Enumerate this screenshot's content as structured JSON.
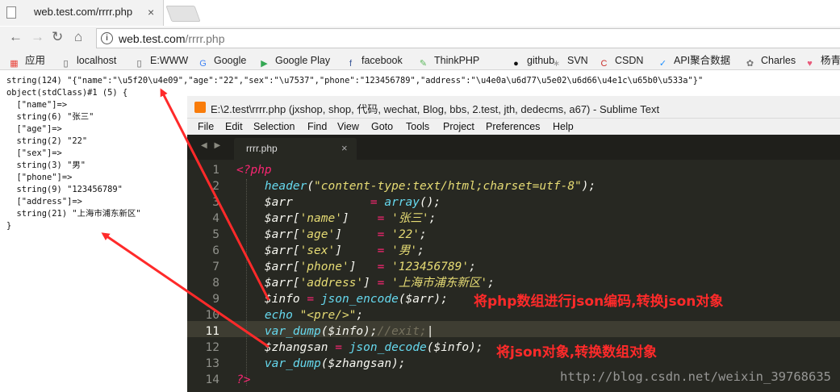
{
  "browser": {
    "tab_title": "web.test.com/rrrr.php",
    "tab_close": "×",
    "url_host": "web.test.com",
    "url_path": "/rrrr.php",
    "nav_back": "←",
    "nav_forward": "→",
    "nav_reload": "↻",
    "nav_home": "⌂",
    "bookmarks": [
      {
        "label": "应用",
        "icon": "apps-grid-icon",
        "glyph": "▦",
        "color": "#e8453c"
      },
      {
        "label": "localhost",
        "icon": "page-icon",
        "glyph": "▯",
        "color": "#555555"
      },
      {
        "label": "E:WWW",
        "icon": "page-icon",
        "glyph": "▯",
        "color": "#555555"
      },
      {
        "label": "Google",
        "icon": "google-icon",
        "glyph": "G",
        "color": "#4285f4"
      },
      {
        "label": "Google Play",
        "icon": "google-play-icon",
        "glyph": "▶",
        "color": "#34a853"
      },
      {
        "label": "facebook",
        "icon": "facebook-icon",
        "glyph": "f",
        "color": "#3b5998"
      },
      {
        "label": "ThinkPHP",
        "icon": "thinkphp-icon",
        "glyph": "✎",
        "color": "#5cb85c"
      },
      {
        "label": "github",
        "icon": "github-icon",
        "glyph": "●",
        "color": "#111111"
      },
      {
        "label": "SVN",
        "icon": "svn-icon",
        "glyph": "∗",
        "color": "#999999"
      },
      {
        "label": "CSDN",
        "icon": "csdn-icon",
        "glyph": "C",
        "color": "#c9302c"
      },
      {
        "label": "API聚合数据",
        "icon": "api-icon",
        "glyph": "✓",
        "color": "#1e90ff"
      },
      {
        "label": "Charles",
        "icon": "charles-icon",
        "glyph": "✿",
        "color": "#777777"
      },
      {
        "label": "杨青",
        "icon": "heart-icon",
        "glyph": "♥",
        "color": "#e85a7a"
      }
    ]
  },
  "output": {
    "lines": [
      "string(124) \"{\"name\":\"\\u5f20\\u4e09\",\"age\":\"22\",\"sex\":\"\\u7537\",\"phone\":\"123456789\",\"address\":\"\\u4e0a\\u6d77\\u5e02\\u6d66\\u4e1c\\u65b0\\u533a\"}\"",
      "object(stdClass)#1 (5) {",
      "  [\"name\"]=>",
      "  string(6) \"张三\"",
      "  [\"age\"]=>",
      "  string(2) \"22\"",
      "  [\"sex\"]=>",
      "  string(3) \"男\"",
      "  [\"phone\"]=>",
      "  string(9) \"123456789\"",
      "  [\"address\"]=>",
      "  string(21) \"上海市浦东新区\"",
      "}"
    ]
  },
  "sublime": {
    "title": "E:\\2.test\\rrrr.php (jxshop, shop, 代码, wechat, Blog, bbs, 2.test, jth, dedecms, a67) - Sublime Text",
    "menu": [
      "File",
      "Edit",
      "Selection",
      "Find",
      "View",
      "Goto",
      "Tools",
      "Project",
      "Preferences",
      "Help"
    ],
    "tab_label": "rrrr.php",
    "tab_close": "×",
    "tab_arrows": "◀ ▶",
    "current_line": 11,
    "code": [
      [
        [
          "<?php",
          "kw"
        ]
      ],
      [
        [
          "    ",
          "pl"
        ],
        [
          "header",
          "fn"
        ],
        [
          "(",
          "pl"
        ],
        [
          "\"content-type:text/html;charset=utf-8\"",
          "st"
        ],
        [
          ");",
          "pl"
        ]
      ],
      [
        [
          "    ",
          "pl"
        ],
        [
          "$arr",
          "va"
        ],
        [
          "           ",
          "pl"
        ],
        [
          "=",
          "kw"
        ],
        [
          " ",
          "pl"
        ],
        [
          "array",
          "fn"
        ],
        [
          "();",
          "pl"
        ]
      ],
      [
        [
          "    ",
          "pl"
        ],
        [
          "$arr",
          "va"
        ],
        [
          "[",
          "pl"
        ],
        [
          "'name'",
          "st"
        ],
        [
          "]    ",
          "pl"
        ],
        [
          "=",
          "kw"
        ],
        [
          " ",
          "pl"
        ],
        [
          "'张三'",
          "st"
        ],
        [
          ";",
          "pl"
        ]
      ],
      [
        [
          "    ",
          "pl"
        ],
        [
          "$arr",
          "va"
        ],
        [
          "[",
          "pl"
        ],
        [
          "'age'",
          "st"
        ],
        [
          "]     ",
          "pl"
        ],
        [
          "=",
          "kw"
        ],
        [
          " ",
          "pl"
        ],
        [
          "'22'",
          "st"
        ],
        [
          ";",
          "pl"
        ]
      ],
      [
        [
          "    ",
          "pl"
        ],
        [
          "$arr",
          "va"
        ],
        [
          "[",
          "pl"
        ],
        [
          "'sex'",
          "st"
        ],
        [
          "]     ",
          "pl"
        ],
        [
          "=",
          "kw"
        ],
        [
          " ",
          "pl"
        ],
        [
          "'男'",
          "st"
        ],
        [
          ";",
          "pl"
        ]
      ],
      [
        [
          "    ",
          "pl"
        ],
        [
          "$arr",
          "va"
        ],
        [
          "[",
          "pl"
        ],
        [
          "'phone'",
          "st"
        ],
        [
          "]   ",
          "pl"
        ],
        [
          "=",
          "kw"
        ],
        [
          " ",
          "pl"
        ],
        [
          "'123456789'",
          "st"
        ],
        [
          ";",
          "pl"
        ]
      ],
      [
        [
          "    ",
          "pl"
        ],
        [
          "$arr",
          "va"
        ],
        [
          "[",
          "pl"
        ],
        [
          "'address'",
          "st"
        ],
        [
          "] ",
          "pl"
        ],
        [
          "=",
          "kw"
        ],
        [
          " ",
          "pl"
        ],
        [
          "'上海市浦东新区'",
          "st"
        ],
        [
          ";",
          "pl"
        ]
      ],
      [
        [
          "    ",
          "pl"
        ],
        [
          "$info",
          "va"
        ],
        [
          " ",
          "pl"
        ],
        [
          "=",
          "kw"
        ],
        [
          " ",
          "pl"
        ],
        [
          "json_encode",
          "fn"
        ],
        [
          "(",
          "pl"
        ],
        [
          "$arr",
          "va"
        ],
        [
          ");",
          "pl"
        ]
      ],
      [
        [
          "    ",
          "pl"
        ],
        [
          "echo",
          "fn"
        ],
        [
          " ",
          "pl"
        ],
        [
          "\"<pre/>\"",
          "st"
        ],
        [
          ";",
          "pl"
        ]
      ],
      [
        [
          "    ",
          "pl"
        ],
        [
          "var_dump",
          "fn"
        ],
        [
          "(",
          "pl"
        ],
        [
          "$info",
          "va"
        ],
        [
          ");",
          "pl"
        ],
        [
          "//exit;",
          "cm"
        ],
        [
          "|",
          "caret"
        ]
      ],
      [
        [
          "    ",
          "pl"
        ],
        [
          "$zhangsan",
          "va"
        ],
        [
          " ",
          "pl"
        ],
        [
          "=",
          "kw"
        ],
        [
          " ",
          "pl"
        ],
        [
          "json_decode",
          "fn"
        ],
        [
          "(",
          "pl"
        ],
        [
          "$info",
          "va"
        ],
        [
          ");",
          "pl"
        ]
      ],
      [
        [
          "    ",
          "pl"
        ],
        [
          "var_dump",
          "fn"
        ],
        [
          "(",
          "pl"
        ],
        [
          "$zhangsan",
          "va"
        ],
        [
          ");",
          "pl"
        ]
      ],
      [
        [
          "?>",
          "kw"
        ]
      ]
    ]
  },
  "annotations": {
    "encode_note": "将php数组进行json编码,转换json对象",
    "decode_note": "将json对象,转换数组对象",
    "watermark": "http://blog.csdn.net/weixin_39768635"
  },
  "colors": {
    "annotation": "#ff2a2a",
    "editor_bg": "#272822",
    "keyword": "#f92672",
    "function": "#66d9ef",
    "string": "#e6db74",
    "comment": "#75715e"
  }
}
